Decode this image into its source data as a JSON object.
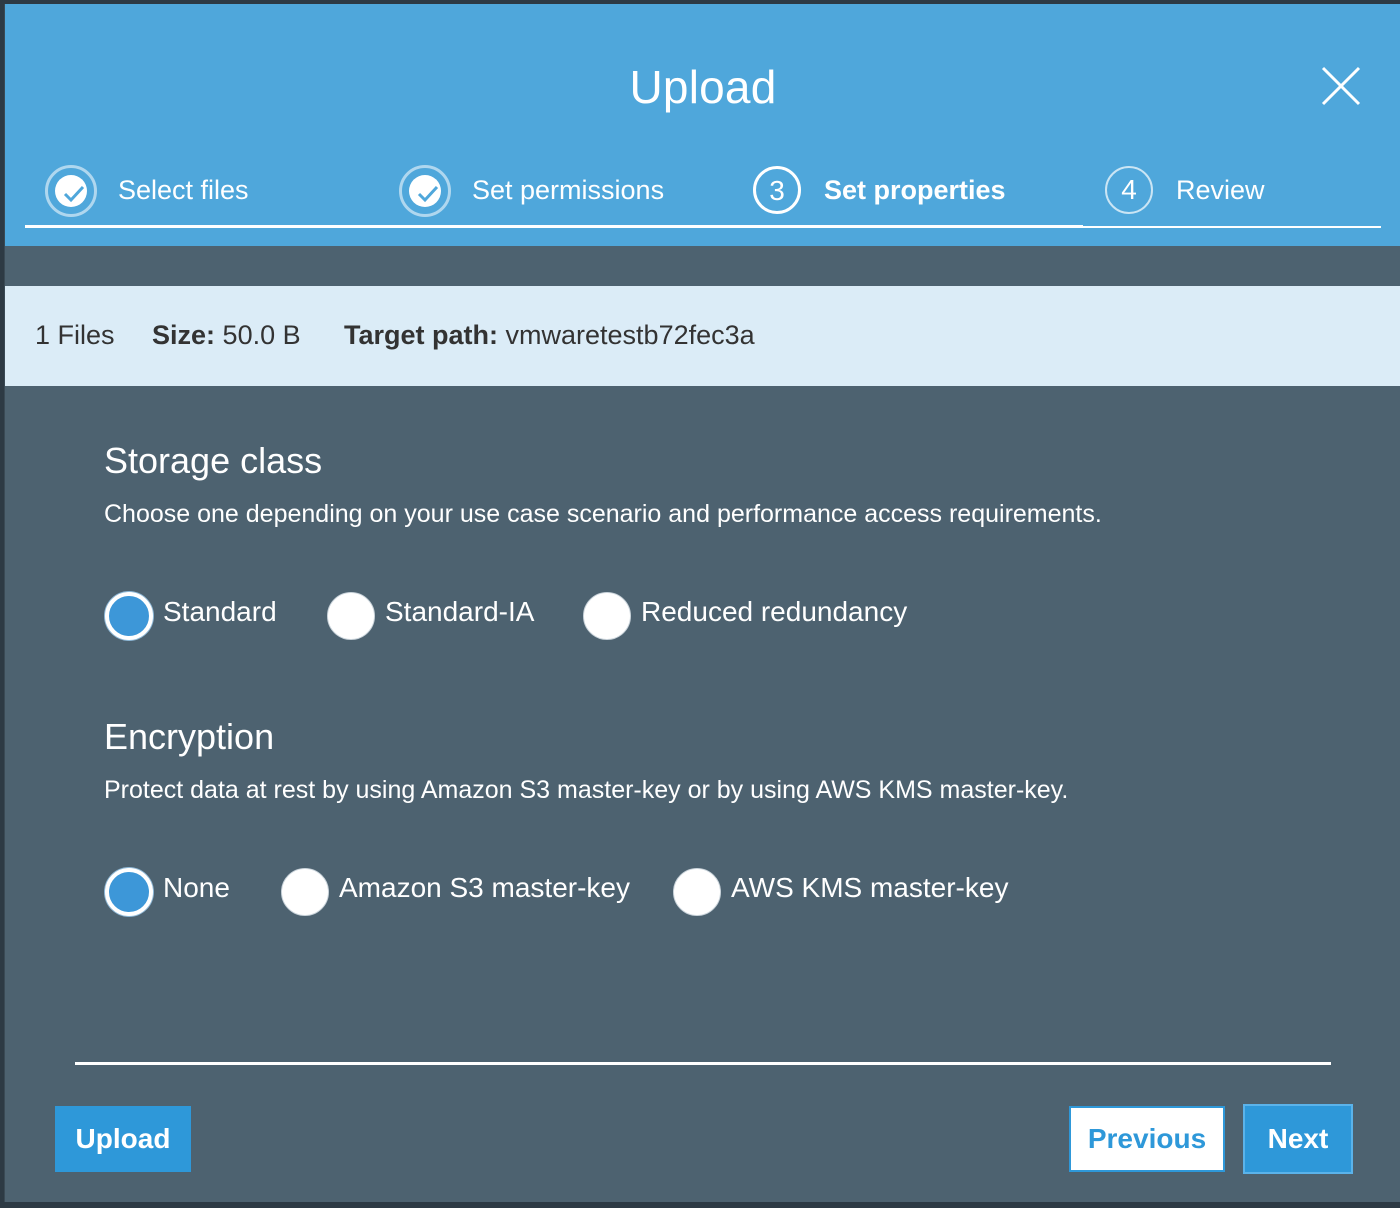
{
  "modal": {
    "title": "Upload"
  },
  "steps": [
    {
      "number": "1",
      "label": "Select files",
      "state": "done"
    },
    {
      "number": "2",
      "label": "Set permissions",
      "state": "done"
    },
    {
      "number": "3",
      "label": "Set properties",
      "state": "active"
    },
    {
      "number": "4",
      "label": "Review",
      "state": "pending"
    }
  ],
  "info": {
    "files": "1 Files",
    "size_label": "Size:",
    "size_value": "50.0 B",
    "target_label": "Target path:",
    "target_value": "vmwaretestb72fec3a"
  },
  "storage": {
    "title": "Storage class",
    "description": "Choose one depending on your use case scenario and performance access requirements.",
    "options": [
      {
        "label": "Standard",
        "selected": true
      },
      {
        "label": "Standard-IA",
        "selected": false
      },
      {
        "label": "Reduced redundancy",
        "selected": false
      }
    ]
  },
  "encryption": {
    "title": "Encryption",
    "description": "Protect data at rest by using Amazon S3 master-key or by using AWS KMS master-key.",
    "options": [
      {
        "label": "None",
        "selected": true
      },
      {
        "label": "Amazon S3 master-key",
        "selected": false
      },
      {
        "label": "AWS KMS master-key",
        "selected": false
      }
    ]
  },
  "footer": {
    "upload_label": "Upload",
    "previous_label": "Previous",
    "next_label": "Next"
  },
  "colors": {
    "header": "#4fa7db",
    "body": "#4d6270",
    "infobar": "#dbecf7",
    "accent": "#2e98d9"
  }
}
